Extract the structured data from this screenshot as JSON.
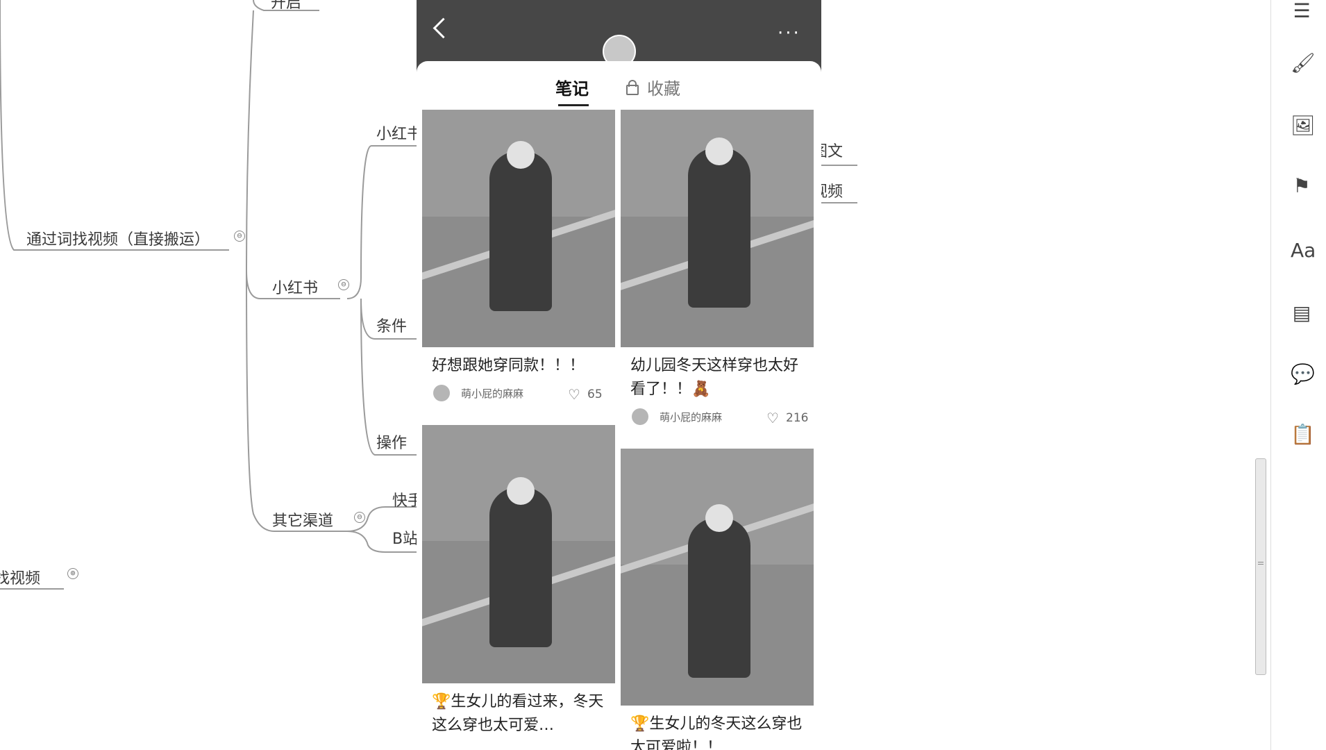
{
  "mindmap": {
    "node_top": "开启",
    "node_main": "通过词找视频（直接搬运）",
    "node_xhs": "小红书",
    "node_xhs_child": "小红书",
    "node_cond": "条件",
    "node_op": "操作",
    "node_other": "其它渠道",
    "node_ks": "快手",
    "node_bz": "B站",
    "node_find": "找视频",
    "node_tuwen": "图文",
    "node_shipin": "视频",
    "collapse_minus": "⊖",
    "collapse_plus": "⊕"
  },
  "phone": {
    "tab_notes": "笔记",
    "tab_fav": "收藏",
    "more_icon": "···",
    "cards": [
      {
        "title": "好想跟她穿同款！！！",
        "author": "萌小屁的麻麻",
        "likes": "65"
      },
      {
        "title": "幼儿园冬天这样穿也太好看了！！🧸",
        "author": "萌小屁的麻麻",
        "likes": "216"
      },
      {
        "title": "🏆生女儿的看过来，冬天这么穿也太可爱…",
        "author": "",
        "likes": ""
      },
      {
        "title": "🏆生女儿的冬天这么穿也太可爱啦！！",
        "author": "",
        "likes": ""
      }
    ]
  },
  "toolbar": {
    "icons": [
      "outline-icon",
      "brush-icon",
      "image-icon",
      "flag-icon",
      "text-style-icon",
      "document-icon",
      "comment-icon",
      "clipboard-icon"
    ]
  }
}
